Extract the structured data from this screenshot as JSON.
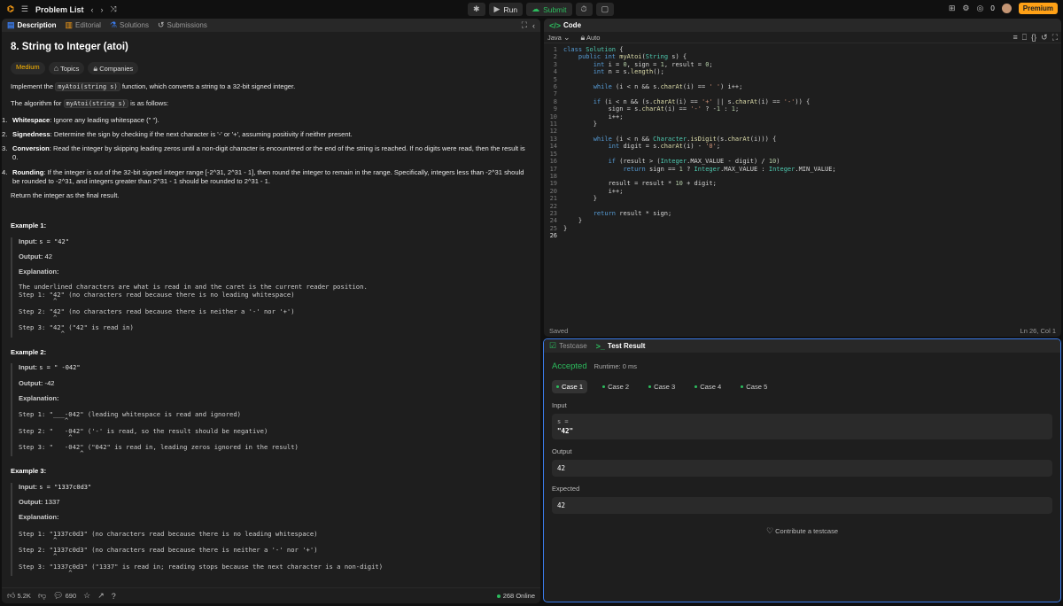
{
  "topbar": {
    "problem_list": "Problem List",
    "run": "Run",
    "submit": "Submit",
    "streak": "0",
    "premium": "Premium"
  },
  "left_tabs": [
    "Description",
    "Editorial",
    "Solutions",
    "Submissions"
  ],
  "problem": {
    "title": "8. String to Integer (atoi)",
    "difficulty": "Medium",
    "topics": "Topics",
    "companies": "Companies",
    "intro_pre": "Implement the",
    "intro_code": "myAtoi(string s)",
    "intro_post": "function, which converts a string to a 32-bit signed integer.",
    "algo_pre": "The algorithm for",
    "algo_code": "myAtoi(string s)",
    "algo_post": "is as follows:",
    "steps": [
      {
        "n": "1.",
        "title": "Whitespace",
        "text": ": Ignore any leading whitespace (\" \")."
      },
      {
        "n": "2.",
        "title": "Signedness",
        "text": ": Determine the sign by checking if the next character is '-' or '+', assuming positivity if neither present."
      },
      {
        "n": "3.",
        "title": "Conversion",
        "text": ": Read the integer by skipping leading zeros until a non-digit character is encountered or the end of the string is reached. If no digits were read, then the result is 0."
      },
      {
        "n": "4.",
        "title": "Rounding",
        "text": ": If the integer is out of the 32-bit signed integer range [-2^31, 2^31 - 1], then round the integer to remain in the range. Specifically, integers less than -2^31 should be rounded to -2^31, and integers greater than 2^31 - 1 should be rounded to 2^31 - 1."
      }
    ],
    "return_text": "Return the integer as the final result."
  },
  "examples": [
    {
      "title": "Example 1:",
      "input": "s = \"42\"",
      "output": "42",
      "explanation_intro": "The underlined characters are what is read in and the caret is the current reader position.",
      "steps": [
        "Step 1: \"42\" (no characters read because there is no leading whitespace)",
        "Step 2: \"42\" (no characters read because there is neither a '-' nor '+')",
        "Step 3: \"42\" (\"42\" is read in)"
      ]
    },
    {
      "title": "Example 2:",
      "input": "s = \" -042\"",
      "output": "-42",
      "explanation_intro": "",
      "steps": [
        "Step 1: \"___-042\" (leading whitespace is read and ignored)",
        "Step 2: \"   -042\" ('-' is read, so the result should be negative)",
        "Step 3: \"   -042\" (\"042\" is read in, leading zeros ignored in the result)"
      ]
    },
    {
      "title": "Example 3:",
      "input": "s = \"1337c0d3\"",
      "output": "1337",
      "explanation_intro": "",
      "steps": [
        "Step 1: \"1337c0d3\" (no characters read because there is no leading whitespace)",
        "Step 2: \"1337c0d3\" (no characters read because there is neither a '-' nor '+')",
        "Step 3: \"1337c0d3\" (\"1337\" is read in; reading stops because the next character is a non-digit)"
      ]
    }
  ],
  "labels": {
    "input": "Input:",
    "output": "Output:",
    "explanation": "Explanation:"
  },
  "left_footer": {
    "likes": "5.2K",
    "comments": "690",
    "online": "268 Online"
  },
  "code_panel": {
    "tab": "Code",
    "lang": "Java",
    "auto": "Auto",
    "saved": "Saved",
    "cursor": "Ln 26, Col 1"
  },
  "result_panel": {
    "tab_testcase": "Testcase",
    "tab_result": "Test Result",
    "status": "Accepted",
    "runtime": "Runtime: 0 ms",
    "cases": [
      "Case 1",
      "Case 2",
      "Case 3",
      "Case 4",
      "Case 5"
    ],
    "input_label": "Input",
    "input_var": "s =",
    "input_val": "\"42\"",
    "output_label": "Output",
    "output_val": "42",
    "expected_label": "Expected",
    "expected_val": "42",
    "contribute": "Contribute a testcase"
  }
}
